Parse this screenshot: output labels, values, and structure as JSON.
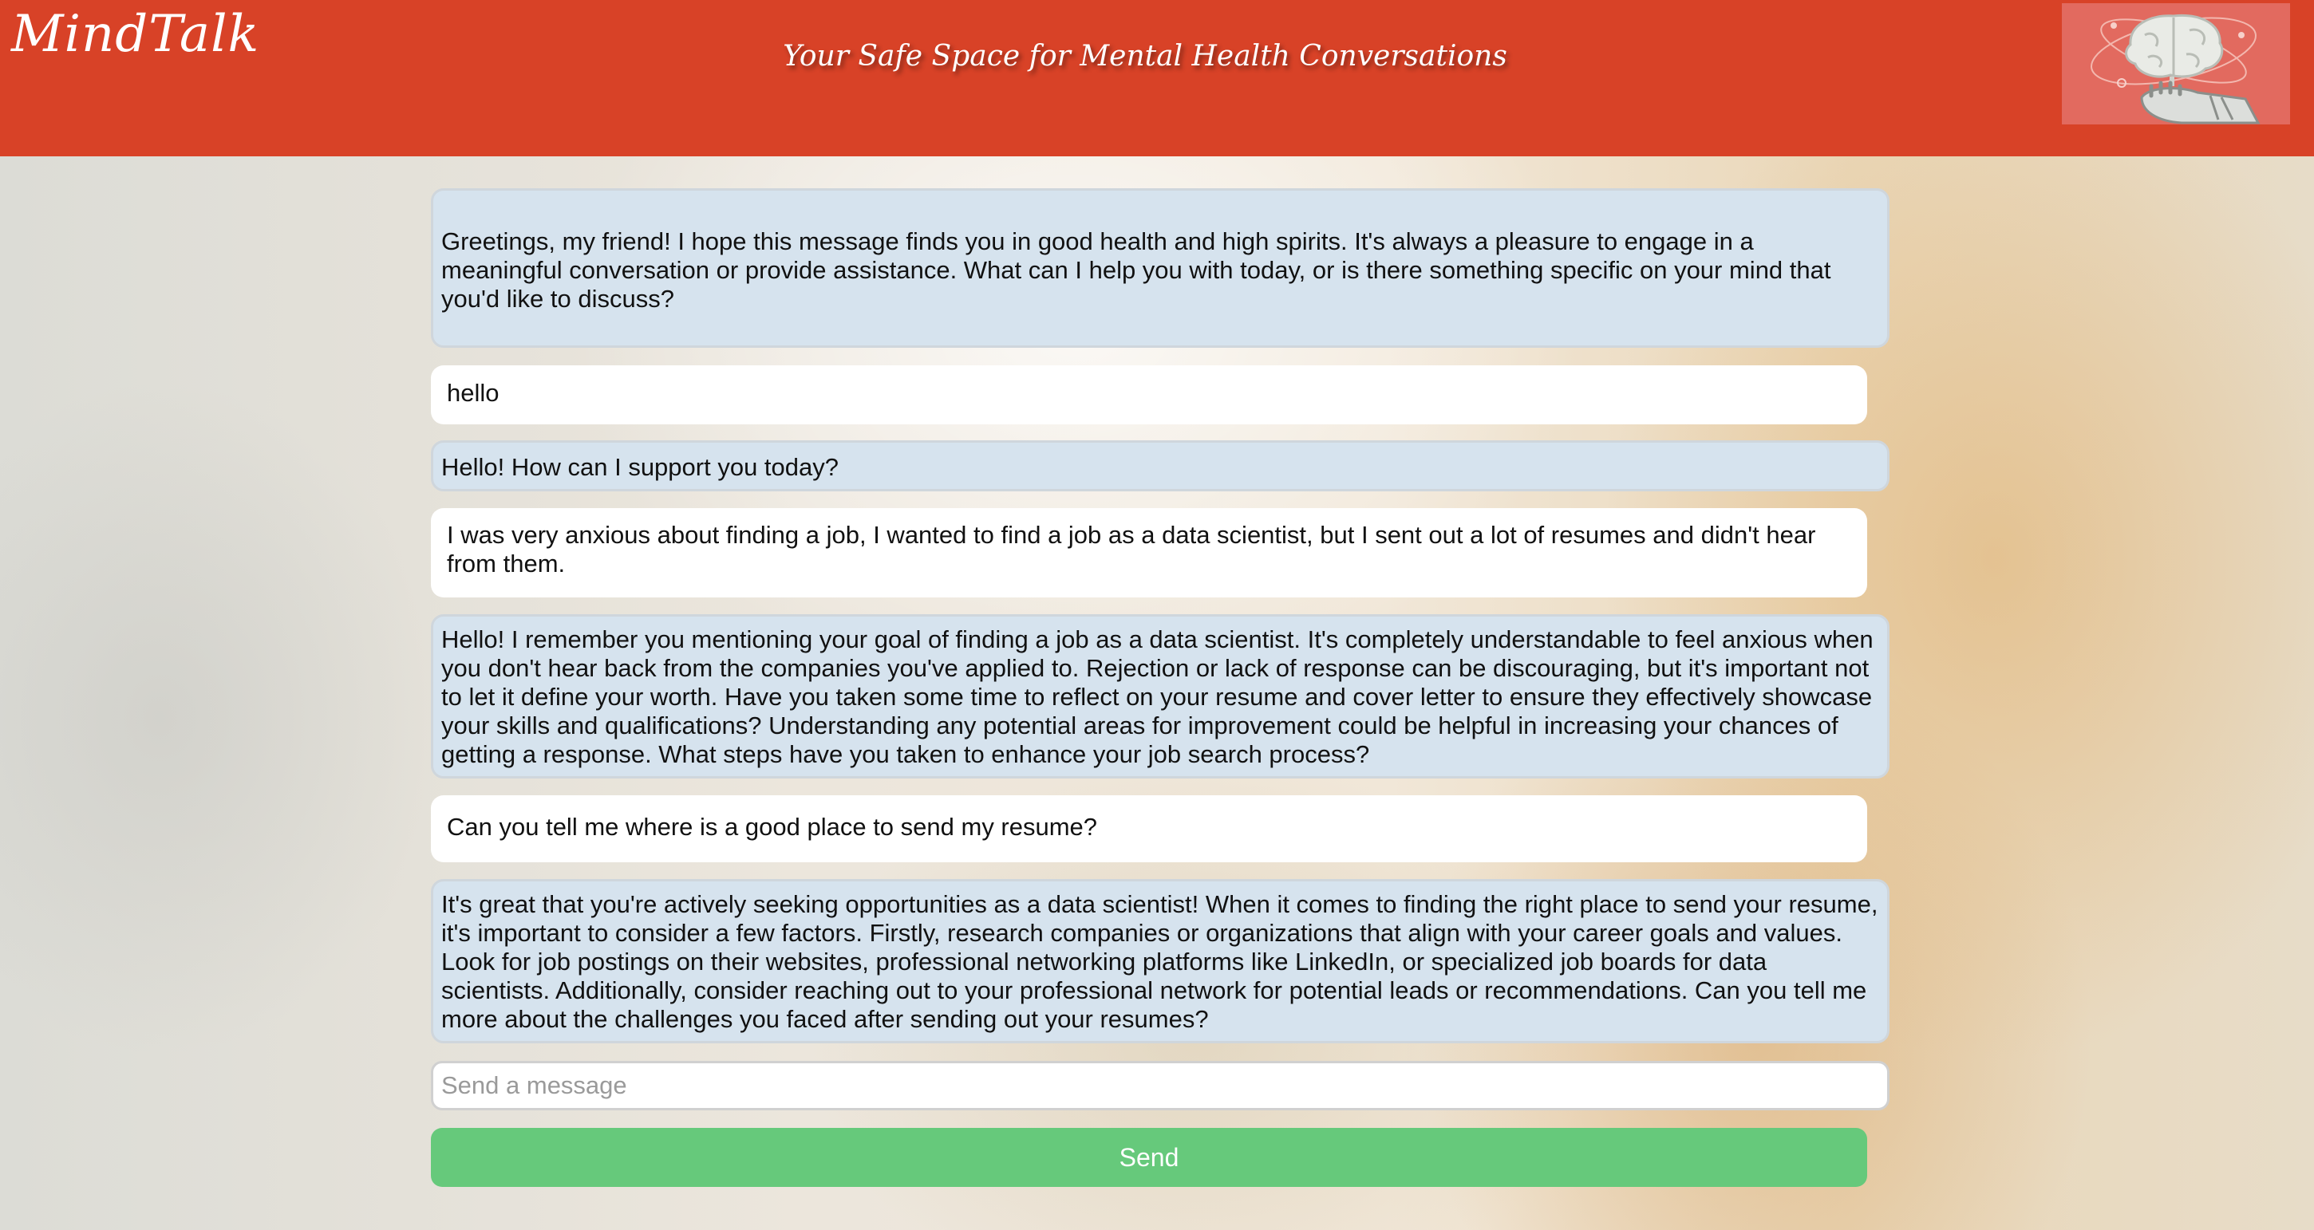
{
  "header": {
    "brand": "MindTalk",
    "tagline": "Your Safe Space for Mental Health Conversations",
    "background_color": "#d84227",
    "logo_icon": "brain-robot-hand-icon"
  },
  "messages": [
    {
      "role": "bot",
      "text": "Greetings, my friend! I hope this message finds you in good health and high spirits. It's always a pleasure to engage in a meaningful conversation or provide assistance. What can I help you with today, or is there something specific on your mind that you'd like to discuss?"
    },
    {
      "role": "user",
      "text": "hello"
    },
    {
      "role": "bot",
      "text": "Hello! How can I support you today?"
    },
    {
      "role": "user",
      "text": "I was very anxious about finding a job, I wanted to find a job as a data scientist, but I sent out a lot of resumes and didn't hear from them."
    },
    {
      "role": "bot",
      "text": "Hello! I remember you mentioning your goal of finding a job as a data scientist. It's completely understandable to feel anxious when you don't hear back from the companies you've applied to. Rejection or lack of response can be discouraging, but it's important not to let it define your worth. Have you taken some time to reflect on your resume and cover letter to ensure they effectively showcase your skills and qualifications? Understanding any potential areas for improvement could be helpful in increasing your chances of getting a response. What steps have you taken to enhance your job search process?"
    },
    {
      "role": "user",
      "text": "Can you tell me where is a good place to send my resume?"
    },
    {
      "role": "bot",
      "text": "It's great that you're actively seeking opportunities as a data scientist! When it comes to finding the right place to send your resume, it's important to consider a few factors. Firstly, research companies or organizations that align with your career goals and values. Look for job postings on their websites, professional networking platforms like LinkedIn, or specialized job boards for data scientists. Additionally, consider reaching out to your professional network for potential leads or recommendations. Can you tell me more about the challenges you faced after sending out your resumes?"
    }
  ],
  "composer": {
    "placeholder": "Send a message",
    "value": "",
    "send_label": "Send",
    "send_color": "#66c97b"
  },
  "colors": {
    "bot_bubble": "#d6e3ee",
    "user_bubble": "#ffffff"
  }
}
